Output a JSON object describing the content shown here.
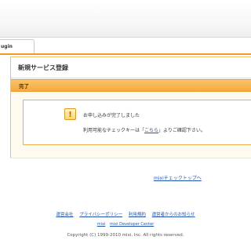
{
  "nav": {
    "tab_label": "ugin"
  },
  "panel": {
    "title": "新規サービス登録",
    "section_title": "完了",
    "message": {
      "icon": "exclamation-icon",
      "line1": "お申し込みが完了しました",
      "line2_before": "利用可能なチェックキーは「",
      "line2_link": "こちら",
      "line2_after": "」よりご確認下さい。"
    }
  },
  "back_link": "mixiチェックトップへ",
  "footer": {
    "links": [
      "運営会社",
      "プライバシーポリシー",
      "利用規約",
      "運営者からのお知らせ"
    ],
    "sub_links": [
      "mixi",
      "mixi Developer Center"
    ],
    "copyright": "Copyright (C) 1999-2010 mixi, Inc. All rights reserved."
  },
  "colors": {
    "accent": "#f7a93d",
    "link": "#2255aa",
    "panel_bg": "#fffaf0"
  }
}
